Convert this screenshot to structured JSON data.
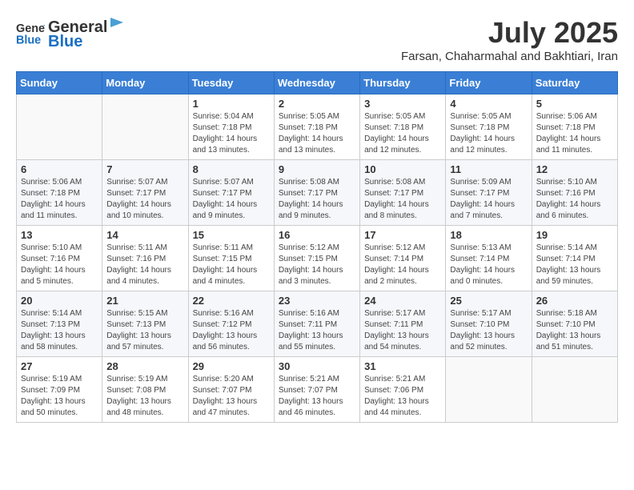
{
  "header": {
    "logo_general": "General",
    "logo_blue": "Blue",
    "month_year": "July 2025",
    "location": "Farsan, Chaharmahal and Bakhtiari, Iran"
  },
  "weekdays": [
    "Sunday",
    "Monday",
    "Tuesday",
    "Wednesday",
    "Thursday",
    "Friday",
    "Saturday"
  ],
  "weeks": [
    [
      {
        "day": "",
        "detail": ""
      },
      {
        "day": "",
        "detail": ""
      },
      {
        "day": "1",
        "detail": "Sunrise: 5:04 AM\nSunset: 7:18 PM\nDaylight: 14 hours\nand 13 minutes."
      },
      {
        "day": "2",
        "detail": "Sunrise: 5:05 AM\nSunset: 7:18 PM\nDaylight: 14 hours\nand 13 minutes."
      },
      {
        "day": "3",
        "detail": "Sunrise: 5:05 AM\nSunset: 7:18 PM\nDaylight: 14 hours\nand 12 minutes."
      },
      {
        "day": "4",
        "detail": "Sunrise: 5:05 AM\nSunset: 7:18 PM\nDaylight: 14 hours\nand 12 minutes."
      },
      {
        "day": "5",
        "detail": "Sunrise: 5:06 AM\nSunset: 7:18 PM\nDaylight: 14 hours\nand 11 minutes."
      }
    ],
    [
      {
        "day": "6",
        "detail": "Sunrise: 5:06 AM\nSunset: 7:18 PM\nDaylight: 14 hours\nand 11 minutes."
      },
      {
        "day": "7",
        "detail": "Sunrise: 5:07 AM\nSunset: 7:17 PM\nDaylight: 14 hours\nand 10 minutes."
      },
      {
        "day": "8",
        "detail": "Sunrise: 5:07 AM\nSunset: 7:17 PM\nDaylight: 14 hours\nand 9 minutes."
      },
      {
        "day": "9",
        "detail": "Sunrise: 5:08 AM\nSunset: 7:17 PM\nDaylight: 14 hours\nand 9 minutes."
      },
      {
        "day": "10",
        "detail": "Sunrise: 5:08 AM\nSunset: 7:17 PM\nDaylight: 14 hours\nand 8 minutes."
      },
      {
        "day": "11",
        "detail": "Sunrise: 5:09 AM\nSunset: 7:17 PM\nDaylight: 14 hours\nand 7 minutes."
      },
      {
        "day": "12",
        "detail": "Sunrise: 5:10 AM\nSunset: 7:16 PM\nDaylight: 14 hours\nand 6 minutes."
      }
    ],
    [
      {
        "day": "13",
        "detail": "Sunrise: 5:10 AM\nSunset: 7:16 PM\nDaylight: 14 hours\nand 5 minutes."
      },
      {
        "day": "14",
        "detail": "Sunrise: 5:11 AM\nSunset: 7:16 PM\nDaylight: 14 hours\nand 4 minutes."
      },
      {
        "day": "15",
        "detail": "Sunrise: 5:11 AM\nSunset: 7:15 PM\nDaylight: 14 hours\nand 4 minutes."
      },
      {
        "day": "16",
        "detail": "Sunrise: 5:12 AM\nSunset: 7:15 PM\nDaylight: 14 hours\nand 3 minutes."
      },
      {
        "day": "17",
        "detail": "Sunrise: 5:12 AM\nSunset: 7:14 PM\nDaylight: 14 hours\nand 2 minutes."
      },
      {
        "day": "18",
        "detail": "Sunrise: 5:13 AM\nSunset: 7:14 PM\nDaylight: 14 hours\nand 0 minutes."
      },
      {
        "day": "19",
        "detail": "Sunrise: 5:14 AM\nSunset: 7:14 PM\nDaylight: 13 hours\nand 59 minutes."
      }
    ],
    [
      {
        "day": "20",
        "detail": "Sunrise: 5:14 AM\nSunset: 7:13 PM\nDaylight: 13 hours\nand 58 minutes."
      },
      {
        "day": "21",
        "detail": "Sunrise: 5:15 AM\nSunset: 7:13 PM\nDaylight: 13 hours\nand 57 minutes."
      },
      {
        "day": "22",
        "detail": "Sunrise: 5:16 AM\nSunset: 7:12 PM\nDaylight: 13 hours\nand 56 minutes."
      },
      {
        "day": "23",
        "detail": "Sunrise: 5:16 AM\nSunset: 7:11 PM\nDaylight: 13 hours\nand 55 minutes."
      },
      {
        "day": "24",
        "detail": "Sunrise: 5:17 AM\nSunset: 7:11 PM\nDaylight: 13 hours\nand 54 minutes."
      },
      {
        "day": "25",
        "detail": "Sunrise: 5:17 AM\nSunset: 7:10 PM\nDaylight: 13 hours\nand 52 minutes."
      },
      {
        "day": "26",
        "detail": "Sunrise: 5:18 AM\nSunset: 7:10 PM\nDaylight: 13 hours\nand 51 minutes."
      }
    ],
    [
      {
        "day": "27",
        "detail": "Sunrise: 5:19 AM\nSunset: 7:09 PM\nDaylight: 13 hours\nand 50 minutes."
      },
      {
        "day": "28",
        "detail": "Sunrise: 5:19 AM\nSunset: 7:08 PM\nDaylight: 13 hours\nand 48 minutes."
      },
      {
        "day": "29",
        "detail": "Sunrise: 5:20 AM\nSunset: 7:07 PM\nDaylight: 13 hours\nand 47 minutes."
      },
      {
        "day": "30",
        "detail": "Sunrise: 5:21 AM\nSunset: 7:07 PM\nDaylight: 13 hours\nand 46 minutes."
      },
      {
        "day": "31",
        "detail": "Sunrise: 5:21 AM\nSunset: 7:06 PM\nDaylight: 13 hours\nand 44 minutes."
      },
      {
        "day": "",
        "detail": ""
      },
      {
        "day": "",
        "detail": ""
      }
    ]
  ]
}
